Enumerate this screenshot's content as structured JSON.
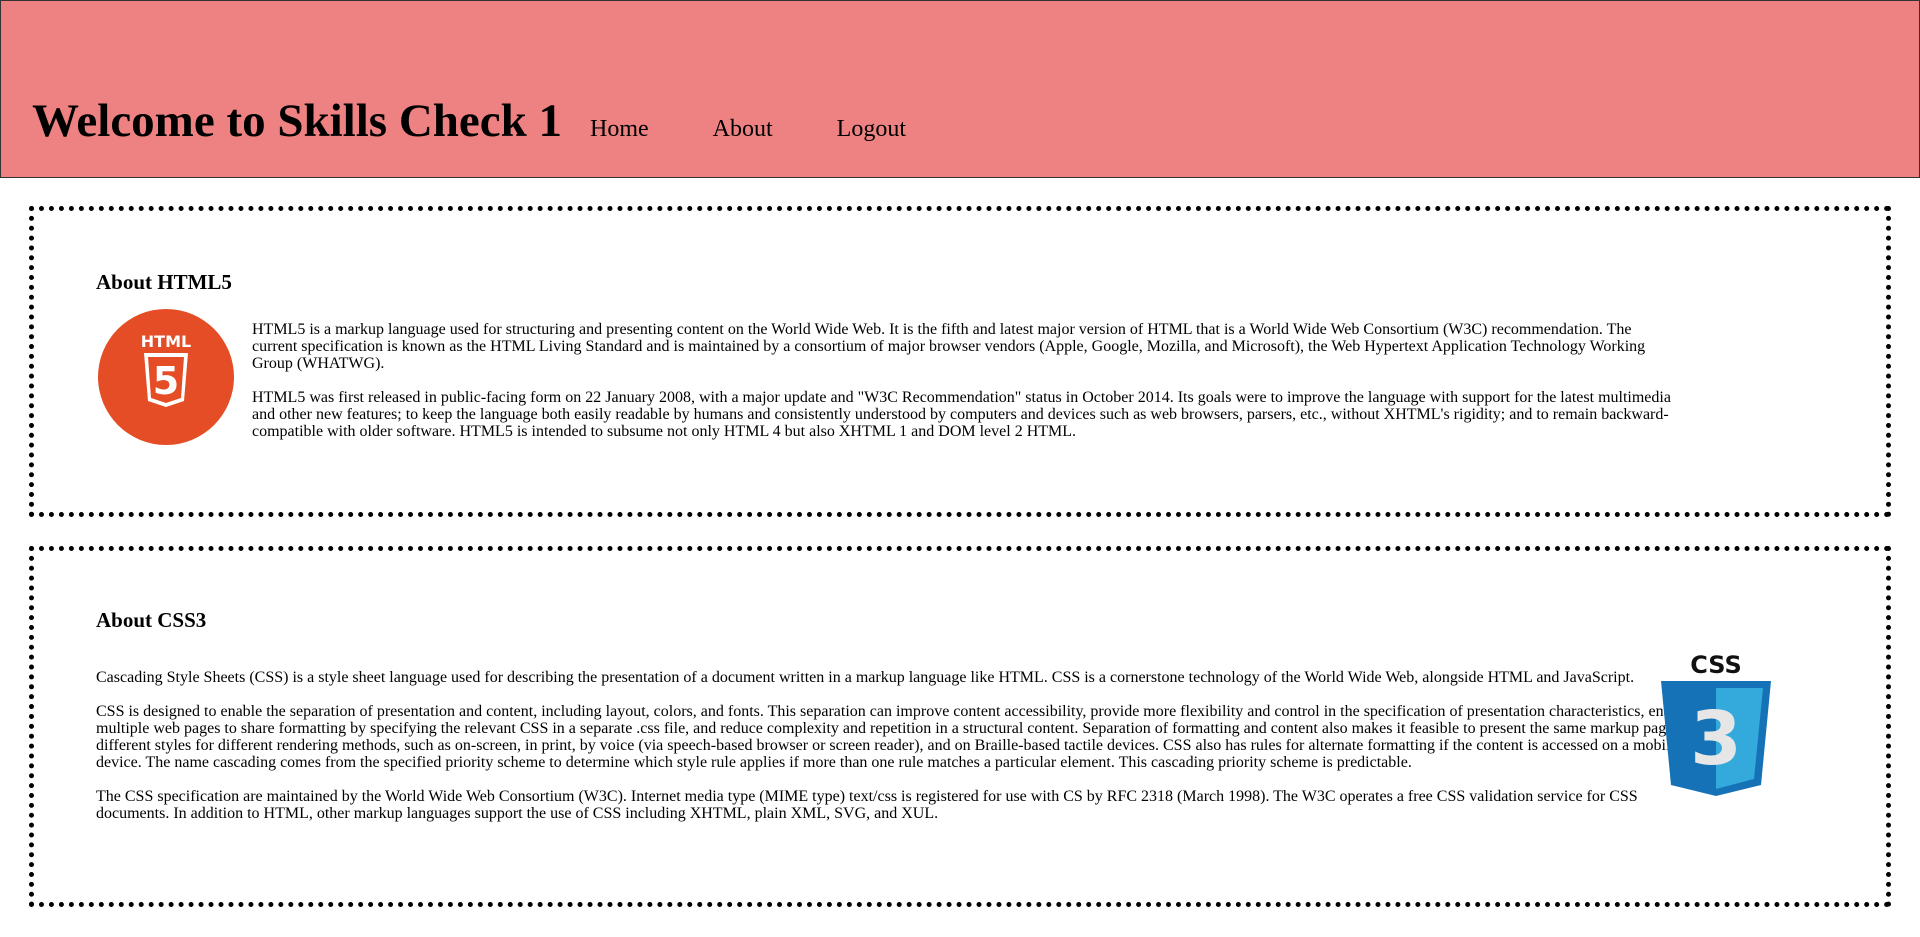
{
  "header": {
    "title": "Welcome to Skills Check 1",
    "nav": [
      "Home",
      "About",
      "Logout"
    ],
    "background": "#ee8282"
  },
  "html_section": {
    "heading": "About HTML5",
    "icon": "html5-logo-icon",
    "logo_text": "HTML",
    "logo_number": "5",
    "paragraphs": [
      "HTML5 is a markup language used for structuring and presenting content on the World Wide Web. It is the fifth and latest major version of HTML that is a World Wide Web Consortium (W3C) recommendation. The current specification is known as the HTML Living Standard and is maintained by a consortium of major browser vendors (Apple, Google, Mozilla, and Microsoft), the Web Hypertext Application Technology Working Group (WHATWG).",
      "HTML5 was first released in public-facing form on 22 January 2008, with a major update and \"W3C Recommendation\" status in October 2014. Its goals were to improve the language with support for the latest multimedia and other new features; to keep the language both easily readable by humans and consistently understood by computers and devices such as web browsers, parsers, etc., without XHTML's rigidity; and to remain backward-compatible with older software. HTML5 is intended to subsume not only HTML 4 but also XHTML 1 and DOM level 2 HTML."
    ],
    "logo_color": "#e44d26"
  },
  "css_section": {
    "heading": "About CSS3",
    "icon": "css3-logo-icon",
    "logo_text": "CSS",
    "logo_number": "3",
    "paragraphs": [
      "Cascading Style Sheets (CSS) is a style sheet language used for describing the presentation of a document written in a markup language like HTML. CSS is a cornerstone technology of the World Wide Web, alongside HTML and JavaScript.",
      "CSS is designed to enable the separation of presentation and content, including layout, colors, and fonts. This separation can improve content accessibility, provide more flexibility and control in the specification of presentation characteristics, enable multiple web pages to share formatting by specifying the relevant CSS in a separate .css file, and reduce complexity and repetition in a structural content. Separation of formatting and content also makes it feasible to present the same markup page in different styles for different rendering methods, such as on-screen, in print, by voice (via speech-based browser or screen reader), and on Braille-based tactile devices. CSS also has rules for alternate formatting if the content is accessed on a mobile device. The name cascading comes from the specified priority scheme to determine which style rule applies if more than one rule matches a particular element. This cascading priority scheme is predictable.",
      "The CSS specification are maintained by the World Wide Web Consortium (W3C). Internet media type (MIME type) text/css is registered for use with CS by RFC 2318 (March 1998). The W3C operates a free CSS validation service for CSS documents. In addition to HTML, other markup languages support the use of CSS including XHTML, plain XML, SVG, and XUL."
    ],
    "logo_color": "#1572b6"
  }
}
